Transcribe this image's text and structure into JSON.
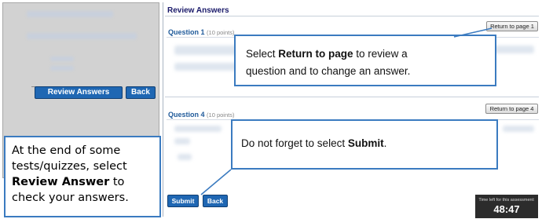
{
  "left_panel": {
    "review_answers_button": "Review Answers",
    "back_button": "Back",
    "callout": {
      "line1": "At the end of some",
      "line2": "tests/quizzes,  select",
      "bold_part": "Review Answer",
      "after_bold": " to",
      "line4": "check your answers."
    }
  },
  "right_panel": {
    "title": "Review Answers",
    "question1": {
      "label": "Question 1",
      "points": "(10 points)",
      "return_button": "Return to page 1"
    },
    "question4": {
      "label": "Question 4",
      "points": "(10 points)",
      "return_button": "Return to page 4"
    },
    "callout1": {
      "prefix": "Select ",
      "bold": "Return to page",
      "line1_suffix": " to review a",
      "line2": "question and to change an answer."
    },
    "callout2": {
      "prefix": "Do not forget to select ",
      "bold": "Submit",
      "suffix": "."
    },
    "submit_button": "Submit",
    "back_button": "Back",
    "timer": {
      "label": "Time left for this assessment:",
      "value": "48:47"
    }
  },
  "colors": {
    "accent_blue": "#1f67b3",
    "callout_border": "#3b7bc0"
  }
}
